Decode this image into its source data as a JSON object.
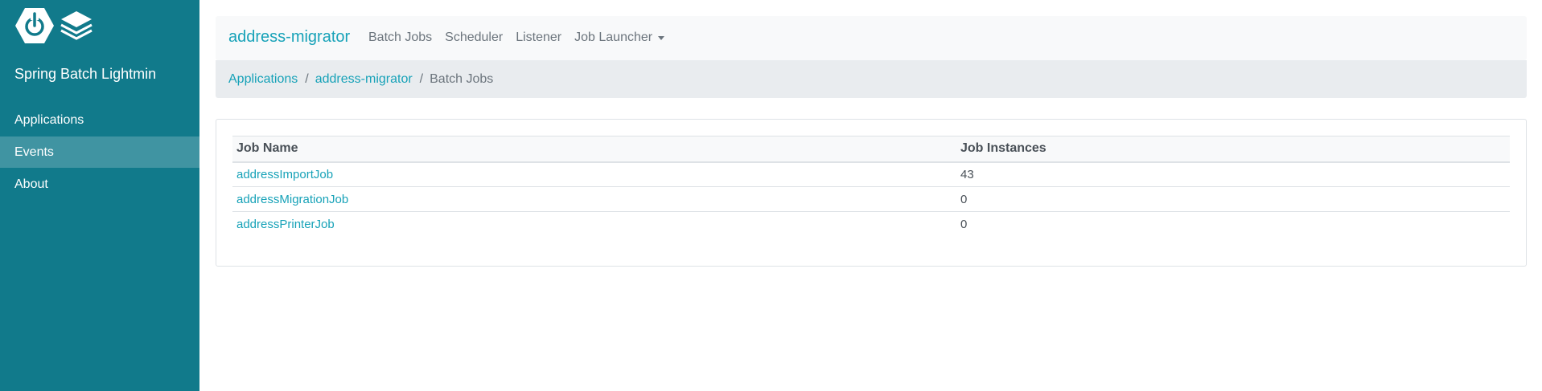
{
  "sidebar": {
    "title": "Spring Batch Lightmin",
    "items": [
      {
        "label": "Applications",
        "active": false
      },
      {
        "label": "Events",
        "active": true
      },
      {
        "label": "About",
        "active": false
      }
    ],
    "bg_color": "#117a8b"
  },
  "navbar": {
    "brand": "address-migrator",
    "links": [
      {
        "label": "Batch Jobs"
      },
      {
        "label": "Scheduler"
      },
      {
        "label": "Listener"
      },
      {
        "label": "Job Launcher",
        "has_dropdown": true
      }
    ]
  },
  "breadcrumb": {
    "items": [
      {
        "label": "Applications",
        "link": true
      },
      {
        "label": "address-migrator",
        "link": true
      },
      {
        "label": "Batch Jobs",
        "link": false
      }
    ],
    "separator": "/"
  },
  "jobs_table": {
    "columns": [
      "Job Name",
      "Job Instances"
    ],
    "rows": [
      {
        "name": "addressImportJob",
        "instances": "43"
      },
      {
        "name": "addressMigrationJob",
        "instances": "0"
      },
      {
        "name": "addressPrinterJob",
        "instances": "0"
      }
    ]
  },
  "colors": {
    "accent": "#17a2b8",
    "sidebar": "#117a8b"
  }
}
